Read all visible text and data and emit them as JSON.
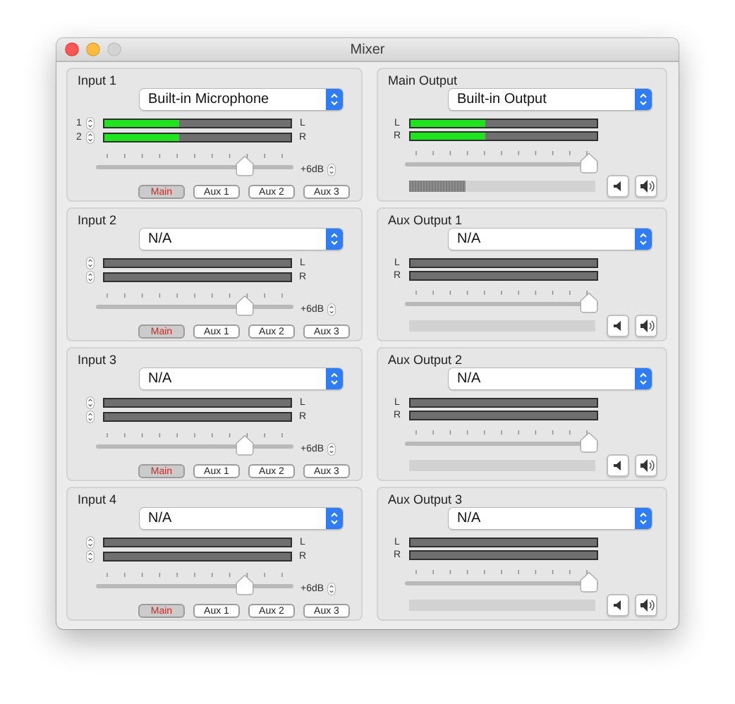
{
  "window": {
    "title": "Mixer"
  },
  "inputs": [
    {
      "title": "Input 1",
      "device": "Built-in Microphone",
      "channels": [
        {
          "label": "1",
          "level": 0.4,
          "side": "L"
        },
        {
          "label": "2",
          "level": 0.4,
          "side": "R"
        }
      ],
      "slider": {
        "level": 0.78
      },
      "reading": "+6dB",
      "sends": [
        {
          "label": "Main",
          "selected": true
        },
        {
          "label": "Aux 1",
          "selected": false
        },
        {
          "label": "Aux 2",
          "selected": false
        },
        {
          "label": "Aux 3",
          "selected": false
        }
      ]
    },
    {
      "title": "Input 2",
      "device": "N/A",
      "channels": [
        {
          "level": 0,
          "side": "L"
        },
        {
          "level": 0,
          "side": "R"
        }
      ],
      "slider": {
        "level": 0.78
      },
      "reading": "+6dB",
      "sends": [
        {
          "label": "Main",
          "selected": true
        },
        {
          "label": "Aux 1",
          "selected": false
        },
        {
          "label": "Aux 2",
          "selected": false
        },
        {
          "label": "Aux 3",
          "selected": false
        }
      ]
    },
    {
      "title": "Input 3",
      "device": "N/A",
      "channels": [
        {
          "level": 0,
          "side": "L"
        },
        {
          "level": 0,
          "side": "R"
        }
      ],
      "slider": {
        "level": 0.78
      },
      "reading": "+6dB",
      "sends": [
        {
          "label": "Main",
          "selected": true
        },
        {
          "label": "Aux 1",
          "selected": false
        },
        {
          "label": "Aux 2",
          "selected": false
        },
        {
          "label": "Aux 3",
          "selected": false
        }
      ]
    },
    {
      "title": "Input 4",
      "device": "N/A",
      "channels": [
        {
          "level": 0,
          "side": "L"
        },
        {
          "level": 0,
          "side": "R"
        }
      ],
      "slider": {
        "level": 0.78
      },
      "reading": "+6dB",
      "sends": [
        {
          "label": "Main",
          "selected": true
        },
        {
          "label": "Aux 1",
          "selected": false
        },
        {
          "label": "Aux 2",
          "selected": false
        },
        {
          "label": "Aux 3",
          "selected": false
        }
      ]
    }
  ],
  "outputs": [
    {
      "title": "Main Output",
      "device": "Built-in Output",
      "channels": [
        {
          "side": "L",
          "level": 0.4
        },
        {
          "side": "R",
          "level": 0.4
        }
      ],
      "slider": {
        "level": 1
      },
      "volume": {
        "level": 0.3
      }
    },
    {
      "title": "Aux Output 1",
      "device": "N/A",
      "channels": [
        {
          "side": "L",
          "level": 0
        },
        {
          "side": "R",
          "level": 0
        }
      ],
      "slider": {
        "level": 1
      },
      "volume": {
        "level": 0
      }
    },
    {
      "title": "Aux Output 2",
      "device": "N/A",
      "channels": [
        {
          "side": "L",
          "level": 0
        },
        {
          "side": "R",
          "level": 0
        }
      ],
      "slider": {
        "level": 1
      },
      "volume": {
        "level": 0
      }
    },
    {
      "title": "Aux Output 3",
      "device": "N/A",
      "channels": [
        {
          "side": "L",
          "level": 0
        },
        {
          "side": "R",
          "level": 0
        }
      ],
      "slider": {
        "level": 1
      },
      "volume": {
        "level": 0
      }
    }
  ]
}
